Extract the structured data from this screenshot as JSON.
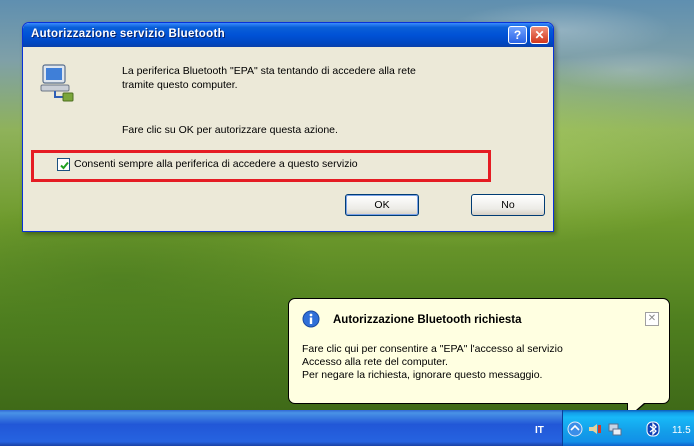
{
  "dialog": {
    "title": "Autorizzazione servizio Bluetooth",
    "help_button": "?",
    "close_button": "✕",
    "message_line1": "La periferica Bluetooth \"EPA\" sta tentando di accedere alla rete",
    "message_line2": "tramite questo computer.",
    "instruction": "Fare clic su OK per autorizzare questa azione.",
    "checkbox_label": "Consenti sempre alla periferica di accedere a questo servizio",
    "checkbox_checked": true,
    "ok_label": "OK",
    "no_label": "No"
  },
  "balloon": {
    "title": "Autorizzazione Bluetooth richiesta",
    "close_label": "✕",
    "line1": "Fare clic qui per consentire a \"EPA\" l'accesso al servizio",
    "line2": "Accesso alla rete del computer.",
    "line3": "Per negare la richiesta, ignorare questo messaggio."
  },
  "taskbar": {
    "language": "IT",
    "clock": "11.5"
  },
  "colors": {
    "highlight": "#e51c23",
    "title_bar": "#0052d6",
    "balloon_bg": "#ffffe1"
  }
}
